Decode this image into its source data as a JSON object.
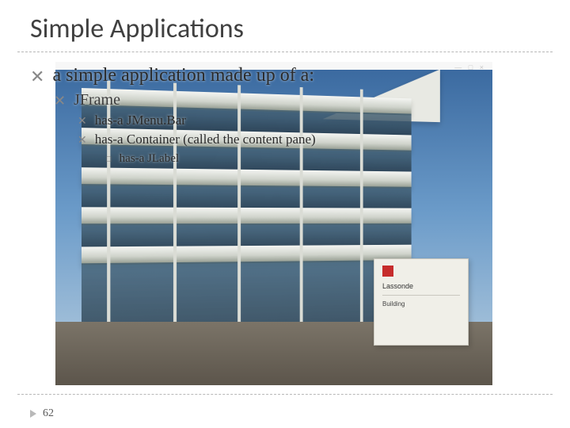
{
  "title": "Simple Applications",
  "bullets": {
    "lvl1": "a simple application made up of a:",
    "lvl2": "JFrame",
    "lvl3a": "has-a JMenu.Bar",
    "lvl3b": "has-a Container (called the content pane)",
    "lvl4": "has-a JLabel"
  },
  "slide_number": "62",
  "sign": {
    "line1": "Lassonde",
    "line2": "Building"
  }
}
